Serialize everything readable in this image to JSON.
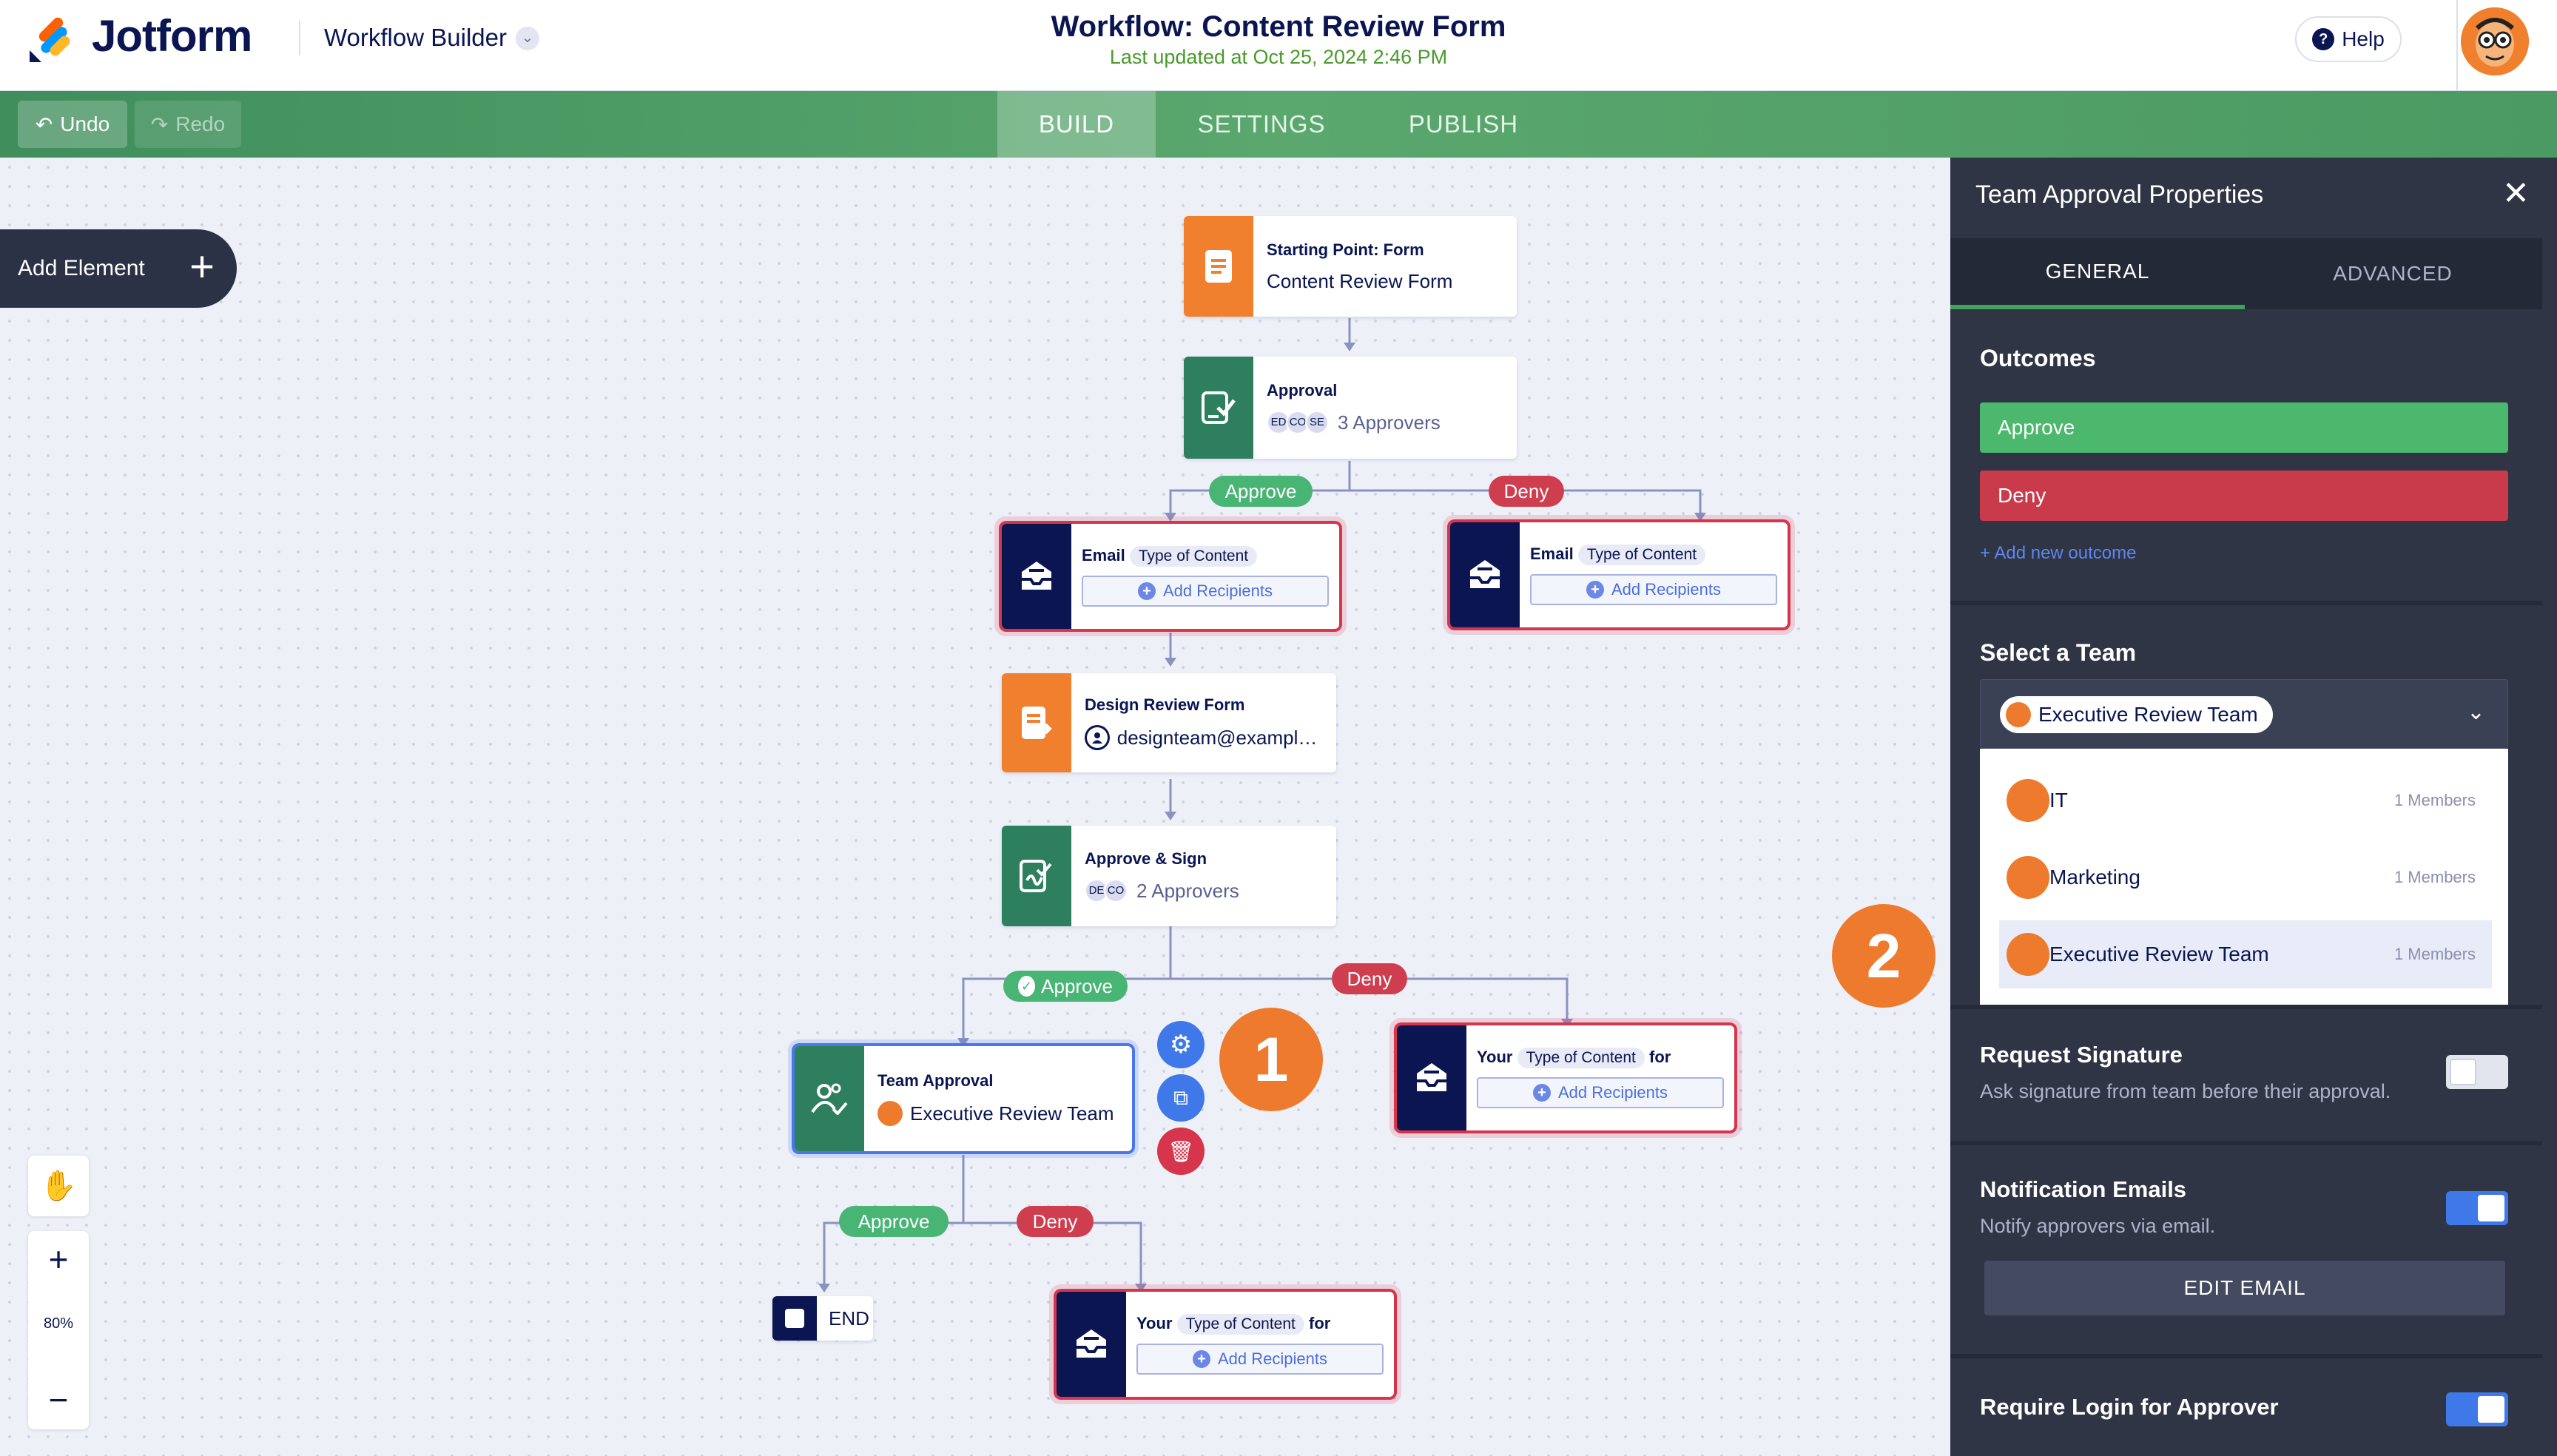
{
  "header": {
    "logo_text": "Jotform",
    "builder_label": "Workflow Builder",
    "workflow_title": "Workflow: Content Review Form",
    "last_updated": "Last updated at Oct 25, 2024 2:46 PM",
    "help_label": "Help"
  },
  "toolbar": {
    "undo_label": "Undo",
    "redo_label": "Redo",
    "tabs": [
      {
        "label": "BUILD",
        "active": true
      },
      {
        "label": "SETTINGS",
        "active": false
      },
      {
        "label": "PUBLISH",
        "active": false
      }
    ]
  },
  "canvas": {
    "add_element_label": "Add Element",
    "zoom_level": "80%",
    "nodes": {
      "start": {
        "title": "Starting Point: Form",
        "subtitle": "Content Review Form"
      },
      "approval": {
        "title": "Approval",
        "avatars": [
          "ED",
          "CO",
          "SE"
        ],
        "approvers": "3 Approvers"
      },
      "email1": {
        "title": "Email",
        "chip": "Type of Content",
        "add_recipients": "Add Recipients"
      },
      "email2": {
        "title": "Email",
        "chip": "Type of Content",
        "add_recipients": "Add Recipients"
      },
      "design_form": {
        "title": "Design Review Form",
        "email": "designteam@example..."
      },
      "approve_sign": {
        "title": "Approve & Sign",
        "avatars": [
          "DE",
          "CO"
        ],
        "approvers": "2 Approvers"
      },
      "team_approval": {
        "title": "Team Approval",
        "team": "Executive Review Team"
      },
      "your_email1": {
        "prefix": "Your",
        "chip": "Type of Content",
        "suffix": "for",
        "add_recipients": "Add Recipients"
      },
      "your_email2": {
        "prefix": "Your",
        "chip": "Type of Content",
        "suffix": "for",
        "add_recipients": "Add Recipients"
      },
      "end": {
        "label": "END"
      }
    },
    "branch_labels": {
      "approve": "Approve",
      "deny": "Deny"
    },
    "step_markers": [
      "1",
      "2"
    ]
  },
  "panel": {
    "title": "Team Approval Properties",
    "tabs": [
      {
        "label": "GENERAL",
        "active": true
      },
      {
        "label": "ADVANCED",
        "active": false
      }
    ],
    "outcomes_heading": "Outcomes",
    "outcomes": [
      {
        "label": "Approve",
        "color": "#4cb86d"
      },
      {
        "label": "Deny",
        "color": "#c93a4b"
      }
    ],
    "add_outcome": "+ Add new outcome",
    "select_team_heading": "Select a Team",
    "selected_team": "Executive Review Team",
    "teams": [
      {
        "name": "IT",
        "members": "1 Members"
      },
      {
        "name": "Marketing",
        "members": "1 Members"
      },
      {
        "name": "Executive Review Team",
        "members": "1 Members"
      }
    ],
    "request_signature": {
      "title": "Request Signature",
      "subtitle": "Ask signature from team before their approval.",
      "enabled": false
    },
    "notification_emails": {
      "title": "Notification Emails",
      "subtitle": "Notify approvers via email.",
      "enabled": true
    },
    "edit_email_label": "EDIT EMAIL",
    "require_login": {
      "title": "Require Login for Approver",
      "enabled": true
    }
  },
  "colors": {
    "brand_navy": "#0a1551",
    "toolbar_green": "#4d9c65",
    "approve_green": "#48b574",
    "deny_red": "#cf3e4f",
    "node_orange": "#f07f2e",
    "node_green": "#2e7f5d",
    "panel_bg": "#2f3545"
  }
}
